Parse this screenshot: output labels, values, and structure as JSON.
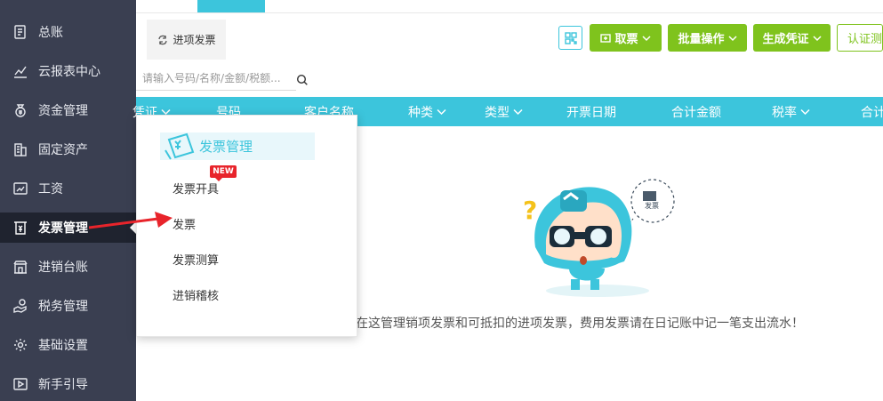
{
  "sidebar": {
    "items": [
      {
        "label": "总账",
        "icon": "ledger-icon"
      },
      {
        "label": "云报表中心",
        "icon": "chart-icon"
      },
      {
        "label": "资金管理",
        "icon": "money-bag-icon"
      },
      {
        "label": "固定资产",
        "icon": "building-icon"
      },
      {
        "label": "工资",
        "icon": "salary-icon"
      },
      {
        "label": "发票管理",
        "icon": "invoice-icon",
        "active": true
      },
      {
        "label": "进销台账",
        "icon": "store-icon"
      },
      {
        "label": "税务管理",
        "icon": "hand-coin-icon"
      },
      {
        "label": "基础设置",
        "icon": "gear-icon"
      },
      {
        "label": "新手引导",
        "icon": "video-icon"
      }
    ]
  },
  "tab": {
    "label": "进项发票"
  },
  "toolbar": {
    "fetch_label": "取票",
    "batch_label": "批量操作",
    "voucher_label": "生成凭证",
    "cert_label": "认证测算"
  },
  "search": {
    "placeholder": "请输入号码/名称/金额/税额..."
  },
  "table": {
    "headers": [
      {
        "label": "凭证",
        "dropdown": true
      },
      {
        "label": "号码",
        "dropdown": false
      },
      {
        "label": "客户名称",
        "dropdown": false
      },
      {
        "label": "种类",
        "dropdown": true
      },
      {
        "label": "类型",
        "dropdown": true
      },
      {
        "label": "开票日期",
        "dropdown": false
      },
      {
        "label": "合计金额",
        "dropdown": false
      },
      {
        "label": "税率",
        "dropdown": true
      },
      {
        "label": "合计",
        "dropdown": false
      }
    ]
  },
  "empty": {
    "message": "在这管理销项发票和可抵扣的进项发票，费用发票请在日记账中记一笔支出流水！",
    "bubble_label": "发票"
  },
  "menu": {
    "title": "发票管理",
    "items": [
      "发票开具",
      "发票",
      "发票测算",
      "进销稽核"
    ],
    "new_badge": "NEW"
  },
  "colors": {
    "sidebar_bg": "#3a3f51",
    "sidebar_active": "#1f232f",
    "accent": "#3cc5dc",
    "green": "#7fc31d",
    "arrow": "#e8242b"
  }
}
